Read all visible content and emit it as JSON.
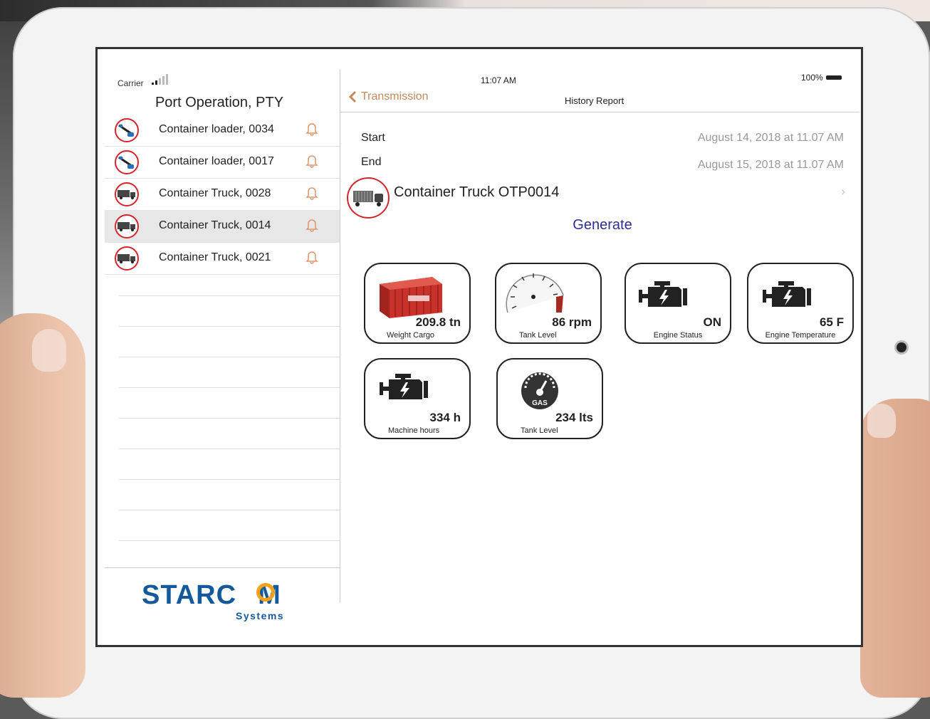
{
  "status_bar": {
    "carrier": "Carrier",
    "time": "11:07 AM",
    "battery": "100%"
  },
  "sidebar": {
    "title": "Port Operation, PTY",
    "items": [
      {
        "label": "Container loader, 0034",
        "icon": "loader-icon",
        "selected": false
      },
      {
        "label": "Container loader, 0017",
        "icon": "loader-icon",
        "selected": false
      },
      {
        "label": "Container Truck, 0028",
        "icon": "truck-icon",
        "selected": false
      },
      {
        "label": "Container Truck, 0014",
        "icon": "truck-icon",
        "selected": true
      },
      {
        "label": "Container Truck, 0021",
        "icon": "truck-icon",
        "selected": false
      }
    ],
    "logo_main": "STARC",
    "logo_end": "M",
    "logo_sub": "Systems"
  },
  "nav": {
    "back_label": "Transmission",
    "title": "History Report"
  },
  "report": {
    "start_label": "Start",
    "end_label": "End",
    "start_value": "August 14, 2018 at 11.07 AM",
    "end_value": "August 15, 2018 at 11.07 AM",
    "vehicle": "Container Truck OTP0014",
    "generate_label": "Generate"
  },
  "tiles": [
    {
      "value": "209.8 tn",
      "label": "Weight Cargo",
      "icon": "shipping-container-icon"
    },
    {
      "value": "86 rpm",
      "label": "Tank Level",
      "icon": "tachometer-icon"
    },
    {
      "value": "ON",
      "label": "Engine Status",
      "icon": "engine-icon"
    },
    {
      "value": "65 F",
      "label": "Engine Temperature",
      "icon": "engine-icon"
    },
    {
      "value": "334 h",
      "label": "Machine hours",
      "icon": "engine-icon"
    },
    {
      "value": "234 lts",
      "label": "Tank Level",
      "icon": "gas-gauge-icon",
      "gauge_text": "GAS"
    }
  ],
  "colors": {
    "accent_red": "#d8232a",
    "back_link": "#c28a5e",
    "generate": "#2b2f8e",
    "brand_blue": "#14599b",
    "brand_orange": "#f4a21a"
  }
}
